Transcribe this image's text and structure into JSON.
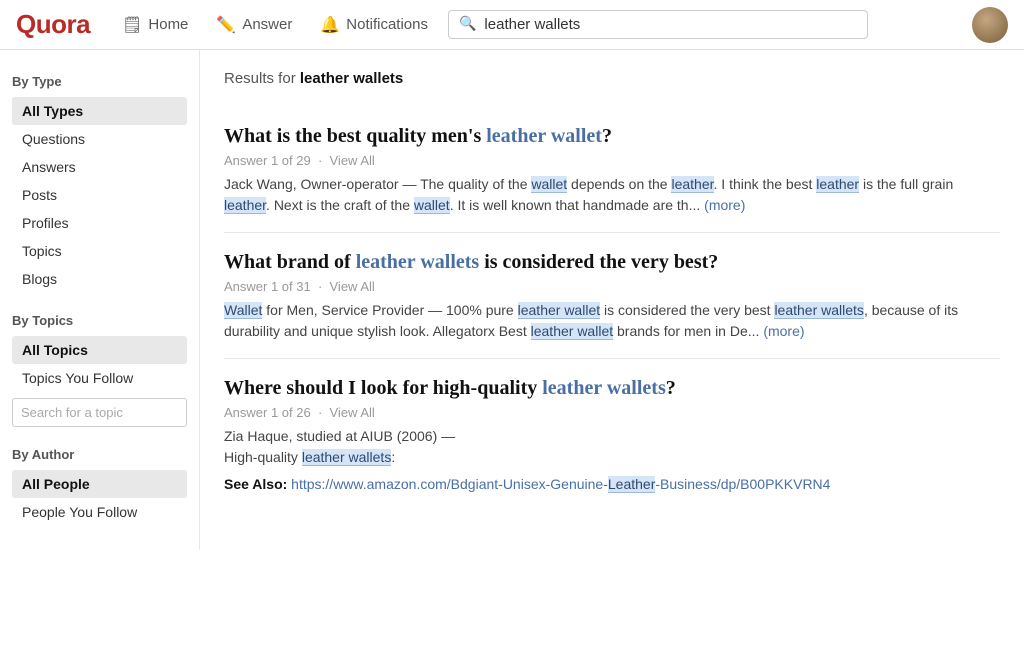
{
  "header": {
    "logo": "Quora",
    "nav": [
      {
        "id": "home",
        "label": "Home",
        "icon": "🗒"
      },
      {
        "id": "answer",
        "label": "Answer",
        "icon": "✏️"
      },
      {
        "id": "notifications",
        "label": "Notifications",
        "icon": "🔔"
      }
    ],
    "search": {
      "placeholder": "leather wallets",
      "value": "leather wallets"
    }
  },
  "sidebar": {
    "by_type": {
      "title": "By Type",
      "items": [
        {
          "id": "all-types",
          "label": "All Types",
          "active": true
        },
        {
          "id": "questions",
          "label": "Questions",
          "active": false
        },
        {
          "id": "answers",
          "label": "Answers",
          "active": false
        },
        {
          "id": "posts",
          "label": "Posts",
          "active": false
        },
        {
          "id": "profiles",
          "label": "Profiles",
          "active": false
        },
        {
          "id": "topics",
          "label": "Topics",
          "active": false
        },
        {
          "id": "blogs",
          "label": "Blogs",
          "active": false
        }
      ]
    },
    "by_topics": {
      "title": "By Topics",
      "items": [
        {
          "id": "all-topics",
          "label": "All Topics",
          "active": true
        },
        {
          "id": "topics-you-follow",
          "label": "Topics You Follow",
          "active": false
        }
      ],
      "search_placeholder": "Search for a topic"
    },
    "by_author": {
      "title": "By Author",
      "items": [
        {
          "id": "all-people",
          "label": "All People",
          "active": true
        },
        {
          "id": "people-you-follow",
          "label": "People You Follow",
          "active": false
        }
      ]
    }
  },
  "results": {
    "query_label": "Results for",
    "query": "leather wallets",
    "items": [
      {
        "id": "result-1",
        "title_plain": "What is the best quality men's",
        "title_highlight": "leather wallet",
        "title_suffix": "?",
        "meta": "Answer 1 of 29",
        "view_all": "View All",
        "snippet": "Jack Wang, Owner-operator — The quality of the wallet depends on the leather. I think the best leather is the full grain leather. Next is the craft of the wallet. It is well known that handmade are th...",
        "more": "(more)",
        "snippet_highlights": [
          "wallet",
          "leather",
          "leather",
          "leather",
          "wallet",
          "wallet"
        ]
      },
      {
        "id": "result-2",
        "title_plain": "What brand of",
        "title_highlight": "leather wallets",
        "title_suffix": " is considered the very best?",
        "meta": "Answer 1 of 31",
        "view_all": "View All",
        "snippet": "Wallet for Men, Service Provider — 100% pure leather wallet is considered the very best leather wallets, because of its durability and unique stylish look. Allegatorx Best leather wallet brands for men in De...",
        "more": "(more)",
        "snippet_highlights": [
          "Wallet",
          "leather wallet",
          "leather wallets",
          "leather wallet"
        ]
      },
      {
        "id": "result-3",
        "title_plain": "Where should I look for high-quality",
        "title_highlight": "leather wallets",
        "title_suffix": "?",
        "meta": "Answer 1 of 26",
        "view_all": "View All",
        "snippet_part1": "Zia Haque, studied at AIUB (2006) —",
        "snippet_part2": "High-quality leather wallets:",
        "snippet_part2_highlight": "leather wallets",
        "see_also_label": "See Also:",
        "see_also_url": "https://www.amazon.com/Bdgiant-Unisex-Genuine-Leather-Business/dp/B00PKKVRN4",
        "see_also_text_plain": "https://www.amazon.com/Bdgiant-Unisex-Genuine-",
        "see_also_highlight": "Leather",
        "see_also_text_suffix": "-Business/dp/B00PKKVRN4"
      }
    ]
  }
}
